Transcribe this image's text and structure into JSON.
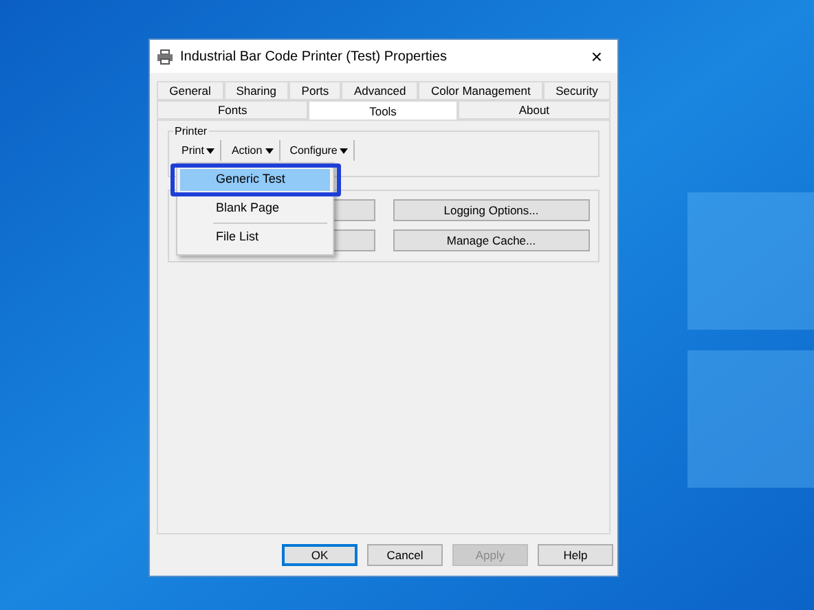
{
  "window": {
    "title": "Industrial Bar Code Printer (Test) Properties",
    "close": "×"
  },
  "tab_rows": [
    [
      {
        "label": "General",
        "selected": false
      },
      {
        "label": "Sharing",
        "selected": false
      },
      {
        "label": "Ports",
        "selected": false
      },
      {
        "label": "Advanced",
        "selected": false
      },
      {
        "label": "Color Management",
        "selected": false
      },
      {
        "label": "Security",
        "selected": false
      }
    ],
    [
      {
        "label": "Fonts",
        "selected": false
      },
      {
        "label": "Tools",
        "selected": true
      },
      {
        "label": "About",
        "selected": false
      }
    ]
  ],
  "printer_group": {
    "label": "Printer",
    "menu_buttons": [
      "Print",
      "Action",
      "Configure"
    ]
  },
  "tools_group": {
    "buttons": [
      {
        "kind": "covered"
      },
      {
        "kind": "labelled",
        "label": "Logging Options..."
      },
      {
        "kind": "covered"
      },
      {
        "kind": "labelled",
        "label": "Manage Cache..."
      }
    ]
  },
  "menu": {
    "items": [
      {
        "kind": "item",
        "label": "Generic Test",
        "selected": true
      },
      {
        "kind": "item",
        "label": "Blank Page",
        "selected": false
      },
      {
        "kind": "separator"
      },
      {
        "kind": "item",
        "label": "File List",
        "selected": false
      }
    ]
  },
  "footer_buttons": [
    {
      "label": "OK",
      "default": true,
      "disabled": false
    },
    {
      "label": "Cancel",
      "default": false,
      "disabled": false
    },
    {
      "label": "Apply",
      "default": false,
      "disabled": true
    },
    {
      "label": "Help",
      "default": false,
      "disabled": false
    }
  ]
}
